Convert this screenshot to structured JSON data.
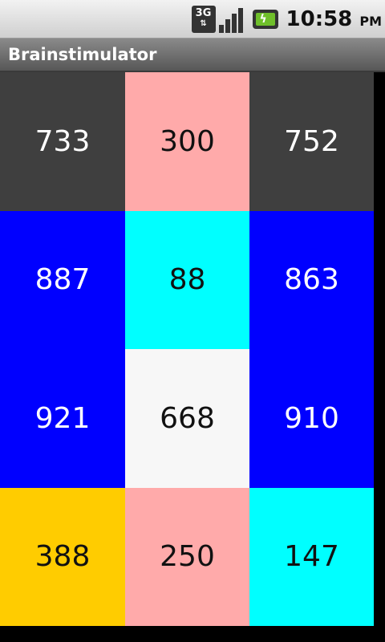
{
  "status_bar": {
    "network_label": "3G",
    "time": "10:58",
    "ampm": "PM"
  },
  "app": {
    "title": "Brainstimulator"
  },
  "tiles": [
    {
      "value": "733",
      "bg": "#3f3f3f",
      "fg": "#ffffff"
    },
    {
      "value": "300",
      "bg": "#ffaaaa",
      "fg": "#111111"
    },
    {
      "value": "752",
      "bg": "#3f3f3f",
      "fg": "#ffffff"
    },
    {
      "value": "887",
      "bg": "#0000ff",
      "fg": "#ffffff"
    },
    {
      "value": "88",
      "bg": "#00ffff",
      "fg": "#111111"
    },
    {
      "value": "863",
      "bg": "#0000ff",
      "fg": "#ffffff"
    },
    {
      "value": "921",
      "bg": "#0000ff",
      "fg": "#ffffff"
    },
    {
      "value": "668",
      "bg": "#f7f7f7",
      "fg": "#111111"
    },
    {
      "value": "910",
      "bg": "#0000ff",
      "fg": "#ffffff"
    },
    {
      "value": "388",
      "bg": "#ffcc00",
      "fg": "#111111"
    },
    {
      "value": "250",
      "bg": "#ffaaaa",
      "fg": "#111111"
    },
    {
      "value": "147",
      "bg": "#00ffff",
      "fg": "#111111"
    }
  ]
}
